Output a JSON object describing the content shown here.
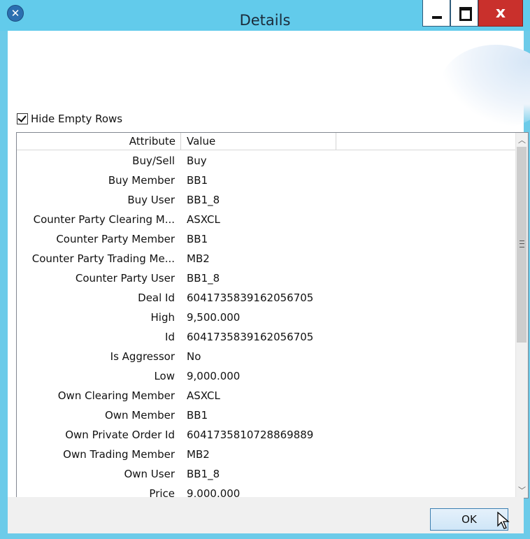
{
  "window": {
    "title": "Details",
    "icon": "app-icon",
    "close_glyph": "x"
  },
  "options": {
    "hide_empty_rows_label": "Hide Empty Rows",
    "hide_empty_rows_checked": true
  },
  "grid": {
    "headers": {
      "attribute": "Attribute",
      "value": "Value"
    },
    "rows": [
      {
        "attribute": "Buy/Sell",
        "value": "Buy"
      },
      {
        "attribute": "Buy Member",
        "value": "BB1"
      },
      {
        "attribute": "Buy User",
        "value": "BB1_8"
      },
      {
        "attribute": "Counter Party Clearing M...",
        "value": "ASXCL"
      },
      {
        "attribute": "Counter Party Member",
        "value": "BB1"
      },
      {
        "attribute": "Counter Party Trading Me...",
        "value": "MB2"
      },
      {
        "attribute": "Counter Party User",
        "value": "BB1_8"
      },
      {
        "attribute": "Deal Id",
        "value": "6041735839162056705"
      },
      {
        "attribute": "High",
        "value": "9,500.000"
      },
      {
        "attribute": "Id",
        "value": "6041735839162056705"
      },
      {
        "attribute": "Is Aggressor",
        "value": "No"
      },
      {
        "attribute": "Low",
        "value": "9,000.000"
      },
      {
        "attribute": "Own Clearing Member",
        "value": "ASXCL"
      },
      {
        "attribute": "Own Member",
        "value": "BB1"
      },
      {
        "attribute": "Own Private Order Id",
        "value": "6041735810728869889"
      },
      {
        "attribute": "Own Trading Member",
        "value": "MB2"
      },
      {
        "attribute": "Own User",
        "value": "BB1_8"
      },
      {
        "attribute": "Price",
        "value": "9,000.000"
      }
    ]
  },
  "footer": {
    "ok_label": "OK"
  }
}
